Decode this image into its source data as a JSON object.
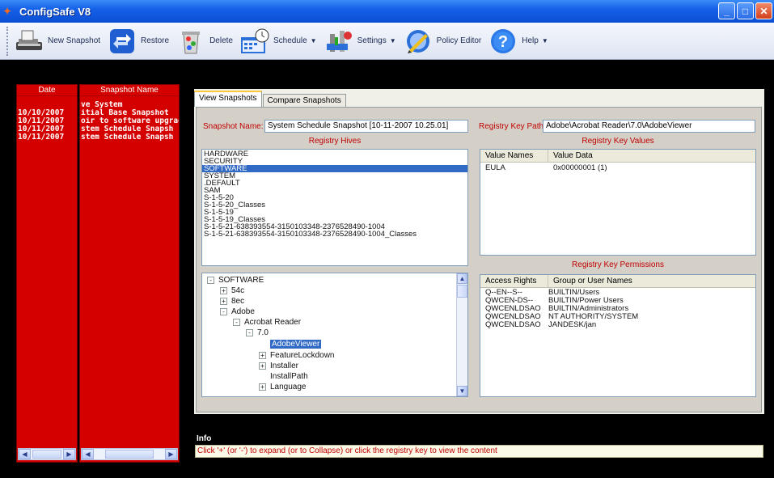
{
  "window": {
    "title": "ConfigSafe V8",
    "controls": [
      "minimize-icon",
      "maximize-icon",
      "close-icon"
    ]
  },
  "toolbar": {
    "items": [
      {
        "label": "New Snapshot",
        "icon": "scanner-icon",
        "dropdown": false
      },
      {
        "label": "Restore",
        "icon": "restore-arrows-icon",
        "dropdown": false
      },
      {
        "label": "Delete",
        "icon": "recycle-bin-icon",
        "dropdown": false
      },
      {
        "label": "Schedule",
        "icon": "calendar-clock-icon",
        "dropdown": true
      },
      {
        "label": "Settings",
        "icon": "settings-tools-icon",
        "dropdown": true
      },
      {
        "label": "Policy Editor",
        "icon": "policy-editor-icon",
        "dropdown": false
      },
      {
        "label": "Help",
        "icon": "help-icon",
        "dropdown": true
      }
    ]
  },
  "snapshots": {
    "date_header": "Date",
    "name_header": "Snapshot Name",
    "rows": [
      {
        "date": "",
        "name": "ve System"
      },
      {
        "date": "10/10/2007",
        "name": "itial Base Snapshot"
      },
      {
        "date": "10/11/2007",
        "name": "oir to software upgrad"
      },
      {
        "date": "10/11/2007",
        "name": "stem Schedule Snapsh"
      },
      {
        "date": "10/11/2007",
        "name": "stem Schedule Snapsh"
      }
    ]
  },
  "tabs": [
    {
      "label": "View Snapshots",
      "active": true
    },
    {
      "label": "Compare Snapshots",
      "active": false
    }
  ],
  "view": {
    "snapshot_name_label": "Snapshot Name:",
    "snapshot_name_value": "System Schedule Snapshot [10-11-2007  10.25.01]",
    "registry_hives_title": "Registry Hives",
    "hives": [
      {
        "label": "HARDWARE",
        "selected": false
      },
      {
        "label": "SECURITY",
        "selected": false
      },
      {
        "label": "SOFTWARE",
        "selected": true
      },
      {
        "label": "SYSTEM",
        "selected": false
      },
      {
        "label": ".DEFAULT",
        "selected": false
      },
      {
        "label": "SAM",
        "selected": false
      },
      {
        "label": "S-1-5-20",
        "selected": false
      },
      {
        "label": "S-1-5-20_Classes",
        "selected": false
      },
      {
        "label": "S-1-5-19",
        "selected": false
      },
      {
        "label": "S-1-5-19_Classes",
        "selected": false
      },
      {
        "label": "S-1-5-21-638393554-3150103348-2376528490-1004",
        "selected": false
      },
      {
        "label": "S-1-5-21-638393554-3150103348-2376528490-1004_Classes",
        "selected": false
      }
    ],
    "tree": [
      {
        "label": "SOFTWARE",
        "expander": "-",
        "depth": 0
      },
      {
        "label": "54c",
        "expander": "+",
        "depth": 1
      },
      {
        "label": "8ec",
        "expander": "+",
        "depth": 1
      },
      {
        "label": "Adobe",
        "expander": "-",
        "depth": 1
      },
      {
        "label": "Acrobat Reader",
        "expander": "-",
        "depth": 2
      },
      {
        "label": "7.0",
        "expander": "-",
        "depth": 3
      },
      {
        "label": "AdobeViewer",
        "expander": "",
        "depth": 4,
        "selected": true
      },
      {
        "label": "FeatureLockdown",
        "expander": "+",
        "depth": 4
      },
      {
        "label": "Installer",
        "expander": "+",
        "depth": 4
      },
      {
        "label": "InstallPath",
        "expander": "",
        "depth": 4
      },
      {
        "label": "Language",
        "expander": "+",
        "depth": 4
      }
    ],
    "registry_key_path_label": "Registry Key Path",
    "registry_key_path_value": "Adobe\\Acrobat Reader\\7.0\\AdobeViewer",
    "key_values_title": "Registry Key Values",
    "key_values_headers": [
      "Value Names",
      "Value Data"
    ],
    "key_values_rows": [
      {
        "name": "EULA",
        "data": "0x00000001 (1)"
      }
    ],
    "permissions_title": "Registry Key Permissions",
    "permissions_headers": [
      "Access Rights",
      "Group or User Names"
    ],
    "permissions_rows": [
      {
        "rights": "Q--EN--S--",
        "group": "BUILTIN/Users"
      },
      {
        "rights": "QWCEN-DS--",
        "group": "BUILTIN/Power Users"
      },
      {
        "rights": "QWCENLDSAO",
        "group": "BUILTIN/Administrators"
      },
      {
        "rights": "QWCENLDSAO",
        "group": "NT AUTHORITY/SYSTEM"
      },
      {
        "rights": "QWCENLDSAO",
        "group": "JANDESK/jan"
      }
    ]
  },
  "info": {
    "label": "Info",
    "message": "Click '+' (or '-') to expand (or to Collapse) or click the registry key to view the content"
  }
}
